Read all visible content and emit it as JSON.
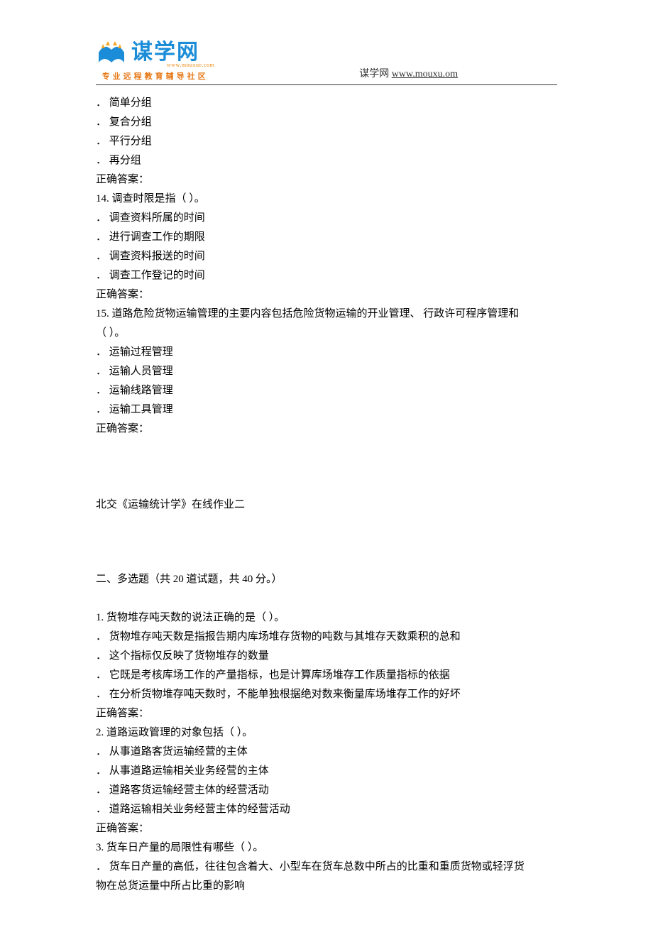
{
  "header": {
    "logo_text": "谋学网",
    "logo_url": "www.mouxue.com",
    "tagline": "专业远程教育辅导社区",
    "site_label": "谋学网",
    "site_url": "www.mouxu.om"
  },
  "q13_prefix_options": {
    "a": "．  简单分组",
    "b": "．  复合分组",
    "c": "．  平行分组",
    "d": "．  再分组"
  },
  "correct_answer_label": "正确答案：",
  "q14": {
    "num": "14.",
    "text": "    调查时限是指（    ）。",
    "opts": {
      "a": "．  调查资料所属的时间",
      "b": "．  进行调查工作的期限",
      "c": "．  调查资料报送的时间",
      "d": "．  调查工作登记的时间"
    }
  },
  "q15": {
    "num": "15.",
    "text1": "    道路危险货物运输管理的主要内容包括危险货物运输的开业管理、         行政许可程序管理和",
    "text2": "（   ）。",
    "opts": {
      "a": "．  运输过程管理",
      "b": "．  运输人员管理",
      "c": "．  运输线路管理",
      "d": "．  运输工具管理"
    }
  },
  "title2": "北交《运输统计学》在线作业二",
  "section2": "二、多选题（共    20    道试题，共    40    分。）",
  "mq1": {
    "num": "1.",
    "text": "    货物堆存吨天数的说法正确的是（       ）。",
    "opts": {
      "a": "．  货物堆存吨天数是指报告期内库场堆存货物的吨数与其堆存天数乘积的总和",
      "b": "．  这个指标仅反映了货物堆存的数量",
      "c": "．  它既是考核库场工作的产量指标，也是计算库场堆存工作质量指标的依据",
      "d": "．  在分析货物堆存吨天数时，不能单独根据绝对数来衡量库场堆存工作的好坏"
    }
  },
  "mq2": {
    "num": "2.",
    "text": "    道路运政管理的对象包括（       ）。",
    "opts": {
      "a": "．  从事道路客货运输经营的主体",
      "b": "．  从事道路运输相关业务经营的主体",
      "c": "．  道路客货运输经营主体的经营活动",
      "d": "．  道路运输相关业务经营主体的经营活动"
    }
  },
  "mq3": {
    "num": "3.",
    "text": "    货车日产量的局限性有哪些（       ）。",
    "opts": {
      "a1": "．  货车日产量的高低，往往包含着大、小型车在货车总数中所占的比重和重质货物或轻浮货",
      "a2": "物在总货运量中所占比重的影响"
    }
  }
}
